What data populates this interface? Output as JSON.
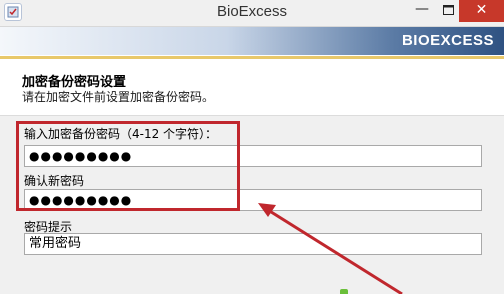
{
  "window": {
    "title": "BioExcess",
    "minimize_glyph": "—",
    "close_glyph": "✕"
  },
  "banner": {
    "brand": "BIOEXCESS"
  },
  "header": {
    "heading": "加密备份密码设置",
    "subheading": "请在加密文件前设置加密备份密码。"
  },
  "form": {
    "password_label": "输入加密备份密码（4-12 个字符）：",
    "password_value": "●●●●●●●●●",
    "confirm_label": "确认新密码",
    "confirm_value": "●●●●●●●●●",
    "hint_label": "密码提示",
    "hint_value": "常用密码"
  },
  "annotation": {
    "highlight_color": "#c0272d"
  },
  "colors": {
    "close_button": "#c7382a",
    "form_background": "#f0f0f0"
  }
}
